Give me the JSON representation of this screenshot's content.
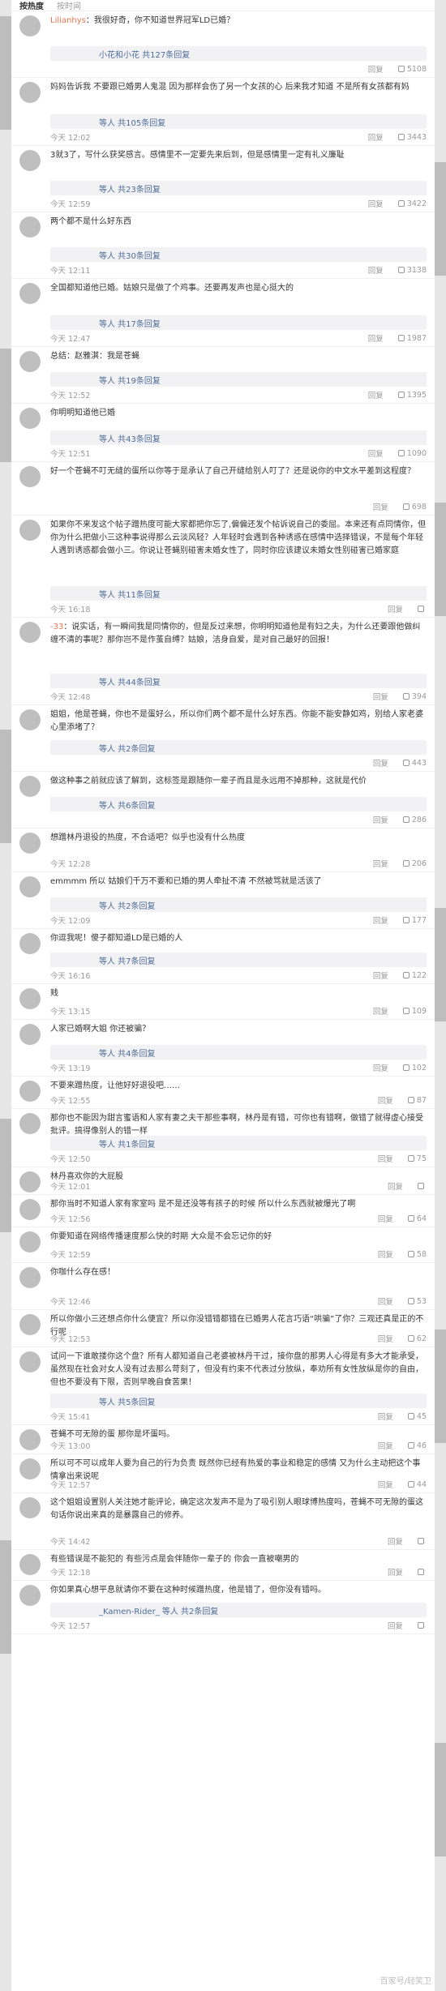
{
  "topbar": {
    "tabs": [
      "按热度",
      "按时间"
    ]
  },
  "labels": {
    "reply": "回复"
  },
  "watermark": "百家号/轻笑卫",
  "comments": [
    {
      "nick": "Lilianhys",
      "text": "我很好奇，你不知道世界冠军LD已婚？",
      "time": "",
      "likes": "5108",
      "sub": "小花和小花 共127条回复"
    },
    {
      "nick": "",
      "text": "妈妈告诉我 不要跟已婚男人鬼混 因为那样会伤了另一个女孩的心 后来我才知道 不是所有女孩都有妈",
      "time": "今天 12:02",
      "likes": "3443",
      "sub": "等人 共105条回复"
    },
    {
      "nick": "",
      "text": "3就3了，写什么获奖感言。感情里不一定要先来后到，但是感情里一定有礼义廉耻",
      "time": "今天 12:59",
      "likes": "3422",
      "sub": "等人 共23条回复"
    },
    {
      "nick": "",
      "text": "两个都不是什么好东西",
      "time": "今天 12:11",
      "likes": "3138",
      "sub": "等人 共30条回复"
    },
    {
      "nick": "",
      "text": "全国都知道他已婚。姑娘只是做了个鸡事。还要再发声也是心挺大的",
      "time": "今天 12:47",
      "likes": "1987",
      "sub": "等人 共17条回复"
    },
    {
      "nick": "",
      "text": "总结：赵雅淇：我是苍蝇",
      "time": "今天 12:52",
      "likes": "1395",
      "sub": "等人 共19条回复"
    },
    {
      "nick": "",
      "text": "你明明知道他已婚",
      "time": "今天 12:51",
      "likes": "1090",
      "sub": "等人 共43条回复"
    },
    {
      "nick": "",
      "text": "好一个苍蝇不叮无缝的蛋所以你等于是承认了自己开缝给别人叮了？还是说你的中文水平差到这程度？",
      "time": "",
      "likes": "698",
      "sub": ""
    },
    {
      "nick": "",
      "text": "如果你不来发这个帖子蹭热度可能大家都把你忘了,偏偏还发个帖诉说自己的委屈。本来还有点同情你，但你为什么把做小三这种事说得那么云淡风轻？人年轻时会遇到各种诱惑在感情中选择错误，不是每个年轻人遇到诱惑都会做小三。你说让苍蝇别碰害未婚女性了，同时你应该建议未婚女性别碰害已婚家庭",
      "time": "今天 16:18",
      "likes": "",
      "sub": "等人 共11条回复"
    },
    {
      "nick": "-33",
      "text": "说实话，有一瞬间我是同情你的，但是反过来想，你明明知道他是有妇之夫，为什么还要跟他做纠缠不清的事呢？那你岂不是作茧自缚？姑娘，洁身自爱，是对自己最好的回报！",
      "time": "今天 12:48",
      "likes": "394",
      "sub": "等人 共44条回复"
    },
    {
      "nick": "",
      "text": "姐姐，他是苍蝇，你也不是蛋好么，所以你们两个都不是什么好东西。你能不能安静如鸡，别给人家老婆心里添堵了？",
      "time": "",
      "likes": "443",
      "sub": "等人 共2条回复"
    },
    {
      "nick": "",
      "text": "做这种事之前就应该了解到，这标签是跟随你一辈子而且是永远用不掉那种，这就是代价",
      "time": "",
      "likes": "286",
      "sub": "等人 共6条回复"
    },
    {
      "nick": "",
      "text": "想蹭林丹退役的热度，不合适吧？似乎也没有什么热度",
      "time": "今天 12:28",
      "likes": "206",
      "sub": ""
    },
    {
      "nick": "",
      "text": "emmmm 所以 姑娘们千万不要和已婚的男人牵扯不清 不然被骂就是活该了",
      "time": "今天 12:09",
      "likes": "177",
      "sub": "等人 共2条回复"
    },
    {
      "nick": "",
      "text": "你逗我呢！傻子都知道LD是已婚的人",
      "time": "今天 16:16",
      "likes": "122",
      "sub": "等人 共7条回复"
    },
    {
      "nick": "",
      "text": "贱",
      "time": "今天 13:15",
      "likes": "109",
      "sub": ""
    },
    {
      "nick": "",
      "text": "人家已婚啊大姐 你还被骗？",
      "time": "今天 13:19",
      "likes": "102",
      "sub": "等人 共4条回复"
    },
    {
      "nick": "",
      "text": "不要来蹭热度，让他好好退役吧……",
      "time": "今天 12:55",
      "likes": "87",
      "sub": ""
    },
    {
      "nick": "",
      "text": "那你也不能因为甜言蜜语和人家有妻之夫干那些事啊，林丹是有错，可你也有错啊，做错了就得虚心接受批评。搞得像别人的错一样",
      "time": "今天 12:50",
      "likes": "75",
      "sub": "等人 共1条回复"
    },
    {
      "nick": "",
      "text": "林丹喜欢你的大屁股",
      "time": "今天 12:01",
      "likes": "",
      "sub": ""
    },
    {
      "nick": "",
      "text": "那你当时不知道人家有家室吗 是不是还没等有孩子的时候 所以什么东西就被爆光了啊",
      "time": "今天 12:56",
      "likes": "64",
      "sub": ""
    },
    {
      "nick": "",
      "text": "你要知道在网络传播速度那么快的时期 大众是不会忘记你的好",
      "time": "今天 12:59",
      "likes": "58",
      "sub": ""
    },
    {
      "nick": "",
      "text": "你咖什么存在感！",
      "time": "今天 12:46",
      "likes": "53",
      "sub": ""
    },
    {
      "nick": "",
      "text": "所以你做小三还想点你什么便宜？所以你没错错都错在已婚男人花言巧语“哄骗”了你？三观还真是正的不行呢",
      "time": "今天 12:53",
      "likes": "62",
      "sub": ""
    },
    {
      "nick": "",
      "text": "试问一下谁敢搂你这个盘？所有人都知道自己老婆被林丹干过，接你盘的那男人心得是有多大才能承受，虽然现在社会对女人没有过去那么苛刻了，但没有约束不代表过分放纵，奉劝所有女性放纵是你的自由，但也不要没有下限，否则早晚自食苦果！",
      "time": "今天 15:41",
      "likes": "45",
      "sub": "等人 共5条回复"
    },
    {
      "nick": "",
      "text": "苍蝇不可无隙的蛋 那你是坏蛋吗。",
      "time": "今天 13:00",
      "likes": "46",
      "sub": ""
    },
    {
      "nick": "",
      "text": "所以可不可以成年人要为自己的行为负责 既然你已经有热爱的事业和稳定的感情 又为什么主动把这个事情拿出来说呢",
      "time": "今天 12:57",
      "likes": "44",
      "sub": ""
    },
    {
      "nick": "",
      "text": "这个姐姐设置别人关注她才能评论，确定这次发声不是为了吸引别人眼球博热度吗，苍蝇不可无隙的蛋这句话你说出来真的是暴露自己的修养。",
      "time": "今天 14:42",
      "likes": "",
      "sub": ""
    },
    {
      "nick": "",
      "text": "有些错误是不能犯的 有些污点是会伴随你一辈子的 你会一直被嘲男的",
      "time": "今天 12:18",
      "likes": "",
      "sub": ""
    },
    {
      "nick": "",
      "text": "你如果真心想平息就请你不要在这种时候蹭热度，他是错了，但你没有错吗。",
      "time": "今天 12:57",
      "likes": "",
      "sub": "_Kamen-Rider_ 等人 共2条回复"
    }
  ]
}
